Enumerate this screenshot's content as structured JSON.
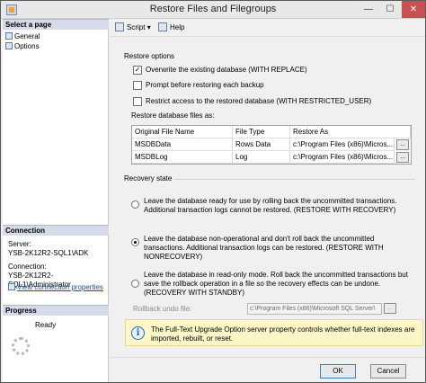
{
  "window": {
    "title": "Restore Files and Filegroups"
  },
  "left_pane": {
    "select_page_header": "Select a page",
    "pages": [
      {
        "label": "General"
      },
      {
        "label": "Options"
      }
    ],
    "connection_header": "Connection",
    "server_label": "Server:",
    "server_value": "YSB-2K12R2-SQL1\\ADK",
    "connection_label": "Connection:",
    "connection_value": "YSB-2K12R2-SQL1\\Administrator",
    "view_connection_link": "View connection properties",
    "progress_header": "Progress",
    "progress_status": "Ready"
  },
  "toolbar": {
    "script_label": "Script",
    "help_label": "Help"
  },
  "restore_options": {
    "header": "Restore options",
    "checkboxes": [
      {
        "label": "Overwrite the existing database (WITH REPLACE)",
        "checked": true
      },
      {
        "label": "Prompt before restoring each backup",
        "checked": false
      },
      {
        "label": "Restrict access to the restored database (WITH RESTRICTED_USER)",
        "checked": false
      }
    ]
  },
  "files_grid": {
    "header": "Restore database files as:",
    "columns": [
      "Original File Name",
      "File Type",
      "Restore As"
    ],
    "rows": [
      [
        "MSDBData",
        "Rows Data",
        "c:\\Program Files (x86)\\Micros..."
      ],
      [
        "MSDBLog",
        "Log",
        "c:\\Program Files (x86)\\Micros..."
      ]
    ],
    "browse_label": "..."
  },
  "recovery": {
    "header": "Recovery state",
    "options": [
      {
        "text": "Leave the database ready for use by rolling back the uncommitted transactions. Additional transaction logs cannot be restored. (RESTORE WITH RECOVERY)",
        "selected": false
      },
      {
        "text": "Leave the database non-operational and don't roll back the uncommitted transactions. Additional transaction logs can be restored. (RESTORE WITH NONRECOVERY)",
        "selected": true
      },
      {
        "text": "Leave the database in read-only mode. Roll back the uncommitted transactions but save the rollback operation in a file so the recovery effects can be undone. (RECOVERY WITH STANDBY)",
        "selected": false
      }
    ],
    "undo_label": "Rollback undo file:",
    "undo_value": "c:\\Program Files (x86)\\Microsoft SQL Server\\"
  },
  "info": {
    "text": "The Full-Text Upgrade Option server property controls whether full-text indexes are imported, rebuilt, or reset."
  },
  "buttons": {
    "ok": "OK",
    "cancel": "Cancel"
  }
}
